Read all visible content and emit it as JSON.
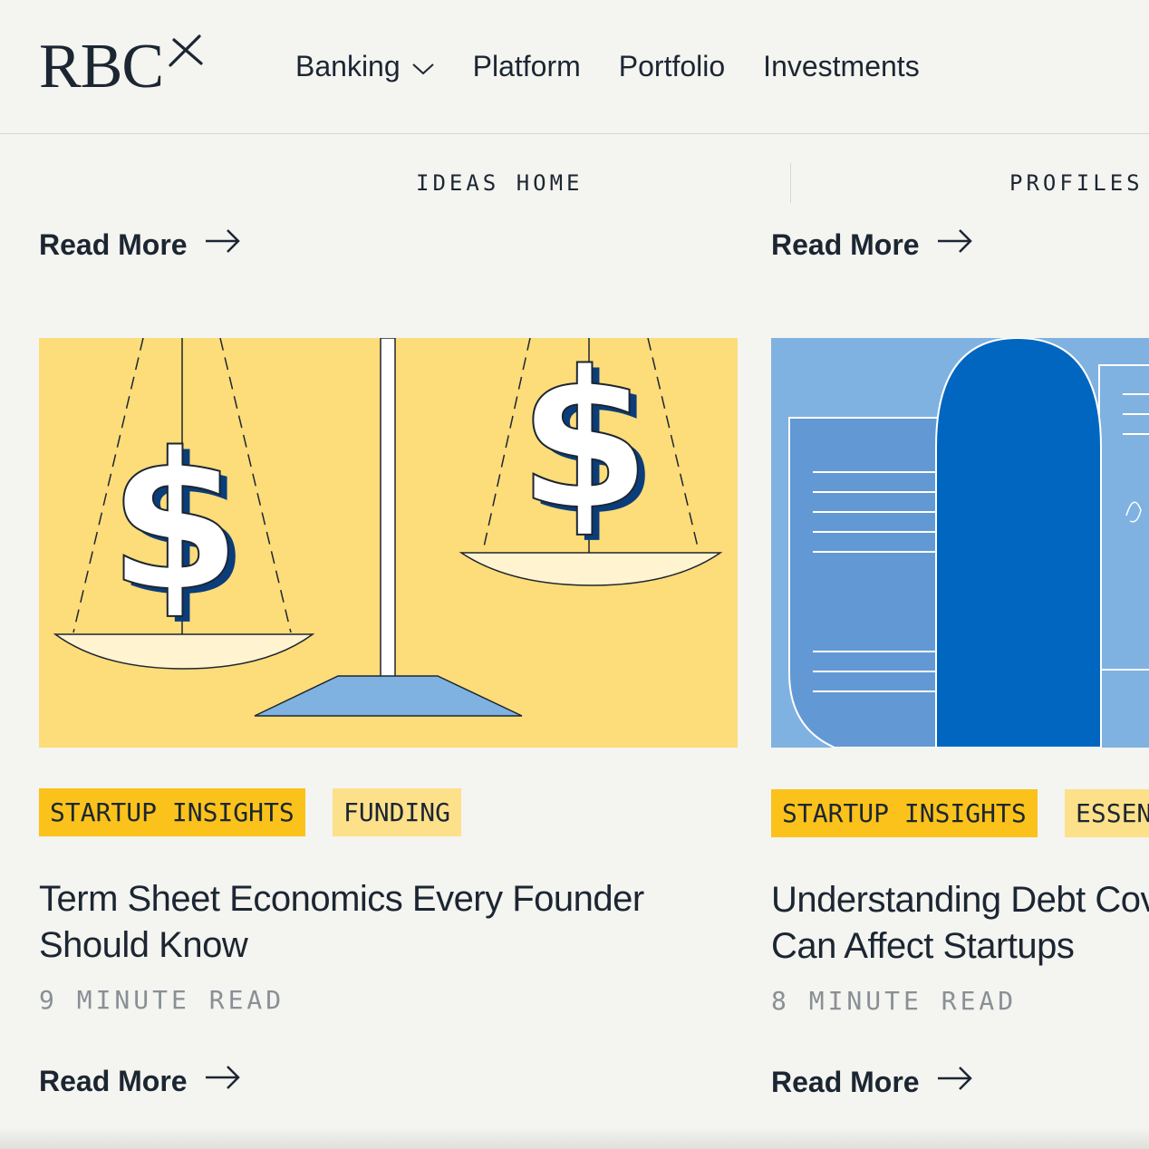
{
  "header": {
    "logo_text": "RBC",
    "nav": [
      {
        "label": "Banking"
      },
      {
        "label": "Platform"
      },
      {
        "label": "Portfolio"
      },
      {
        "label": "Investments"
      }
    ]
  },
  "subnav": {
    "left": "IDEAS HOME",
    "right": "PROFILES"
  },
  "top_links": {
    "left": "Read More",
    "right": "Read More"
  },
  "cards": [
    {
      "tags": [
        "STARTUP INSIGHTS",
        "FUNDING"
      ],
      "title_line1": "Term Sheet Economics Every Founder",
      "title_line2": "Should Know",
      "read_time": "9 MINUTE READ",
      "link": "Read More"
    },
    {
      "tags": [
        "STARTUP INSIGHTS",
        "ESSEN"
      ],
      "title_line1": "Understanding Debt Cov",
      "title_line2": "Can Affect Startups",
      "read_time": "8 MINUTE READ",
      "link": "Read More"
    }
  ],
  "colors": {
    "ink": "#1c2632",
    "tag_primary": "#fbc21b",
    "tag_secondary": "#fde08a",
    "card1_bg": "#fddc7a",
    "card2_bg": "#7fb2e0",
    "card2_accent": "#0066c0"
  }
}
